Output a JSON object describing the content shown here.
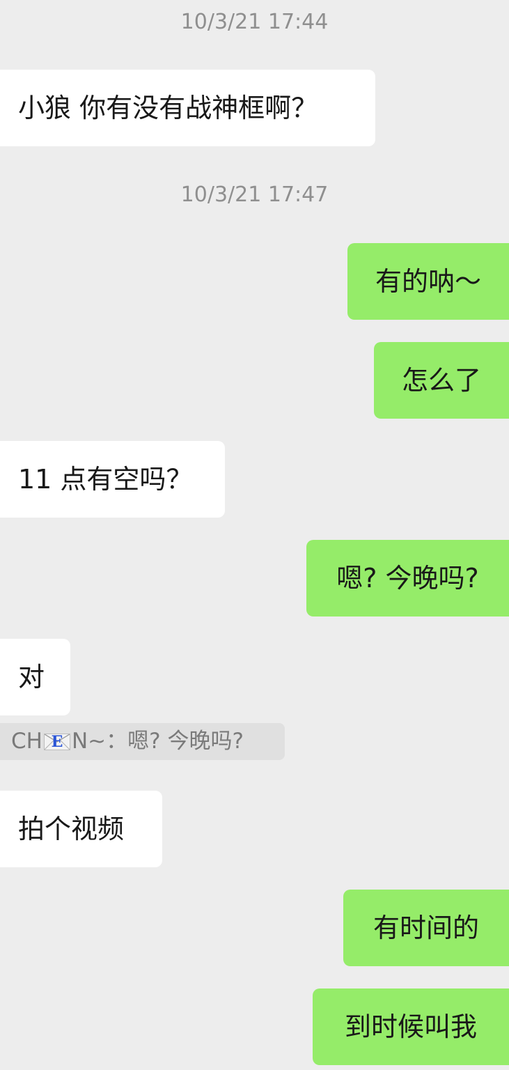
{
  "messages": {
    "ts1": "10/3/21 17:44",
    "m1": "小狼 你有没有战神框啊？",
    "ts2": "10/3/21 17:47",
    "m2": "有的呐～",
    "m3": "怎么了",
    "m4": "11 点有空吗？",
    "m5": "嗯? 今晚吗?",
    "m6": "对",
    "quote": {
      "name_prefix": "CH",
      "envelope_letter": "E",
      "name_suffix": "N~",
      "text": "：嗯? 今晚吗?"
    },
    "m7": "拍个视频",
    "m8": "有时间的",
    "m9": "到时候叫我"
  },
  "colors": {
    "background": "#ededed",
    "incoming_bubble": "#ffffff",
    "outgoing_bubble": "#95ec69",
    "timestamp_text": "#8f8f8f",
    "quote_background": "#e0e0e0"
  },
  "icons": {
    "quote_name_icon": "envelope-icon"
  }
}
